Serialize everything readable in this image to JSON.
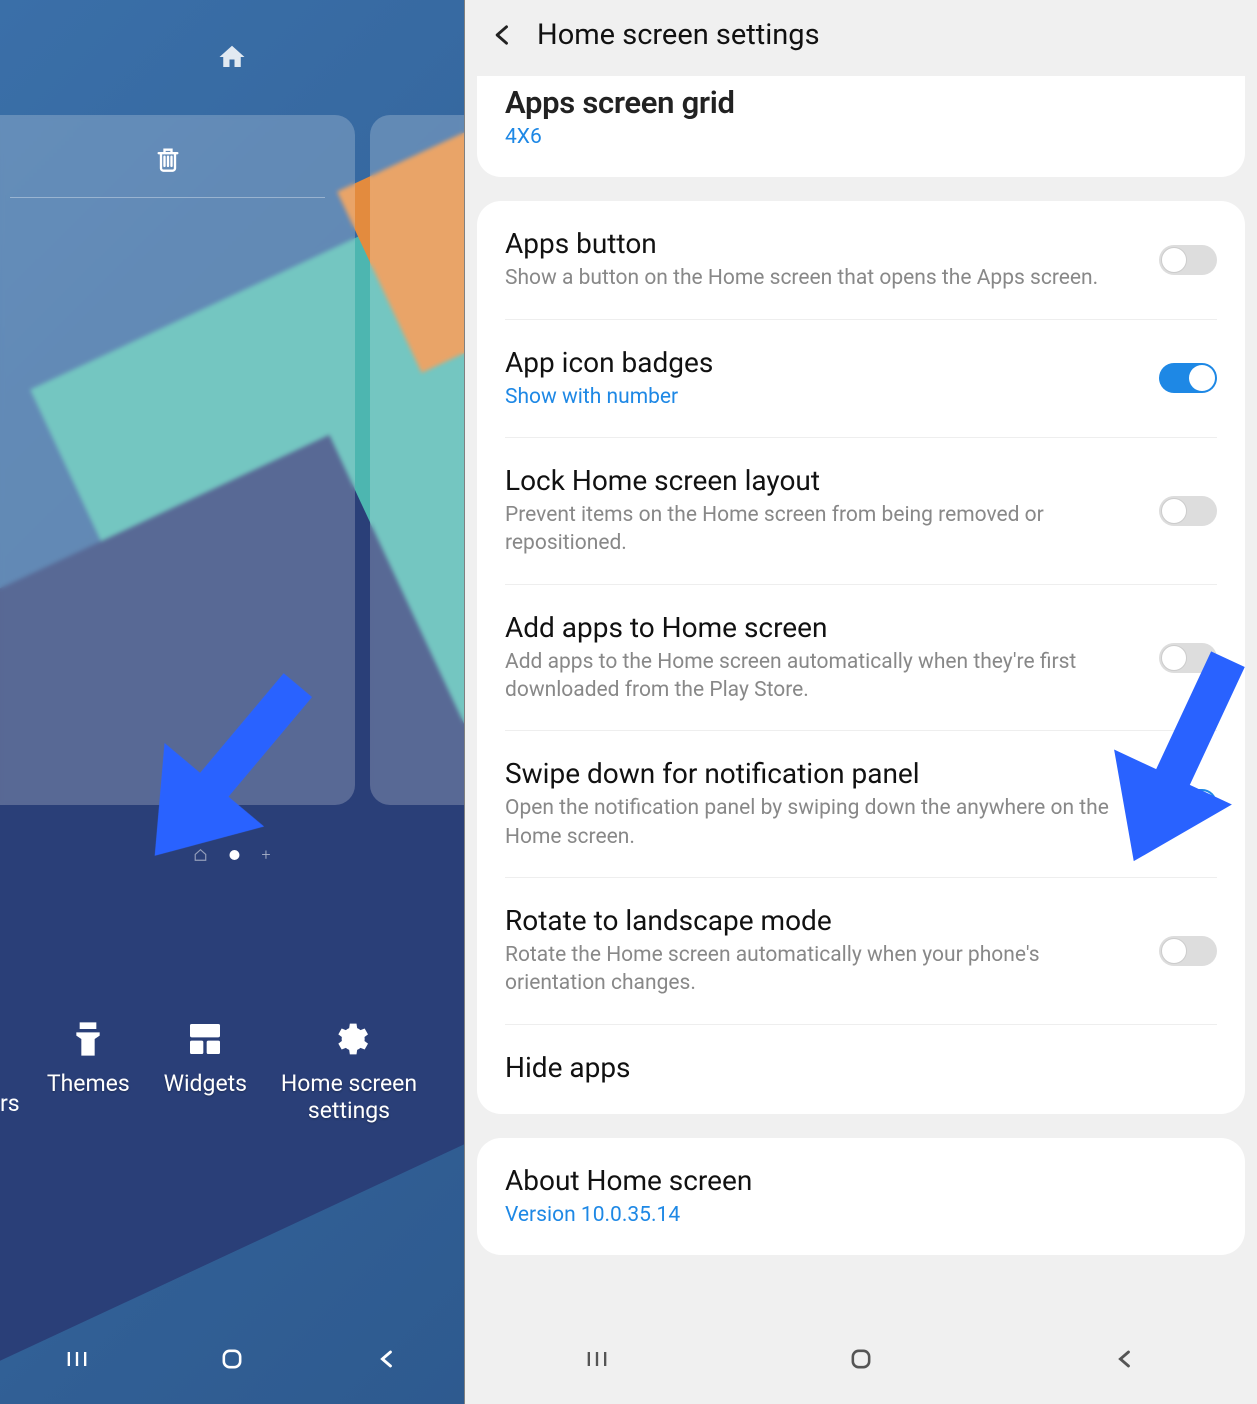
{
  "left": {
    "actions": {
      "themes": "Themes",
      "widgets": "Widgets",
      "home_settings": "Home screen\nsettings",
      "wallpapers_cut": "rs"
    }
  },
  "right": {
    "header_title": "Home screen settings",
    "partial": {
      "title": "Apps screen grid",
      "sub": "4X6"
    },
    "apps_button": {
      "title": "Apps button",
      "sub": "Show a button on the Home screen that opens the Apps screen."
    },
    "app_icon_badges": {
      "title": "App icon badges",
      "sub": "Show with number"
    },
    "lock_layout": {
      "title": "Lock Home screen layout",
      "sub": "Prevent items on the Home screen from being removed or repositioned."
    },
    "add_apps": {
      "title": "Add apps to Home screen",
      "sub": "Add apps to the Home screen automatically when they're first downloaded from the Play Store."
    },
    "swipe_down": {
      "title": "Swipe down for notification panel",
      "sub": "Open the notification panel by swiping down the anywhere on the Home screen."
    },
    "rotate": {
      "title": "Rotate to landscape mode",
      "sub": "Rotate the Home screen automatically when your phone's orientation changes."
    },
    "hide_apps": {
      "title": "Hide apps"
    },
    "about": {
      "title": "About Home screen",
      "sub": "Version 10.0.35.14"
    }
  }
}
